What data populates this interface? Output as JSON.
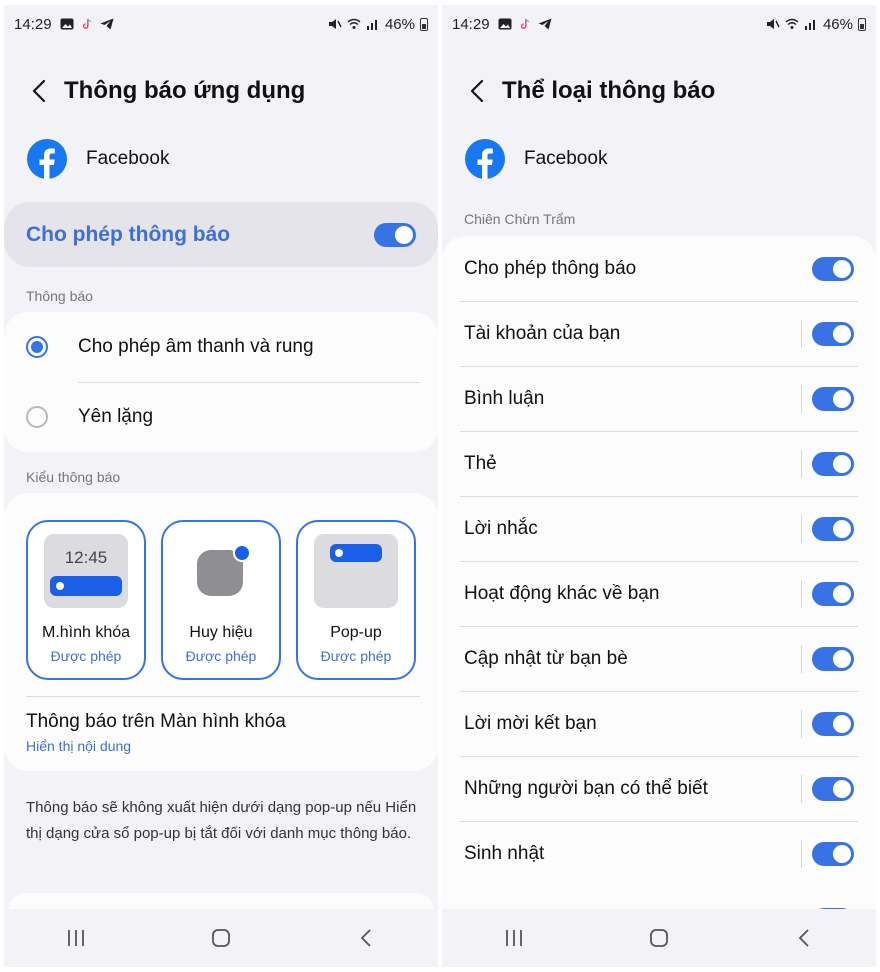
{
  "status_bar": {
    "time": "14:29",
    "battery": "46%"
  },
  "left": {
    "title": "Thông báo ứng dụng",
    "app_name": "Facebook",
    "allow_label": "Cho phép thông báo",
    "section_notifications": "Thông báo",
    "options": [
      {
        "label": "Cho phép âm thanh và rung",
        "selected": true
      },
      {
        "label": "Yên lặng",
        "selected": false
      }
    ],
    "section_style": "Kiểu thông báo",
    "styles": [
      {
        "label": "M.hình khóa",
        "status": "Được phép",
        "preview_time": "12:45"
      },
      {
        "label": "Huy hiệu",
        "status": "Được phép"
      },
      {
        "label": "Pop-up",
        "status": "Được phép"
      }
    ],
    "lockscreen": {
      "title": "Thông báo trên Màn hình khóa",
      "value": "Hiển thị nội dung"
    },
    "note": "Thông báo sẽ không xuất hiện dưới dạng pop-up nếu Hiển thị dạng cửa sổ pop-up bị tắt đối với danh mục thông báo."
  },
  "right": {
    "title": "Thể loại thông báo",
    "app_name": "Facebook",
    "section": "Chiên Chừn Trẩm",
    "categories": [
      {
        "label": "Cho phép thông báo",
        "on": true
      },
      {
        "label": "Tài khoản của bạn",
        "on": true
      },
      {
        "label": "Bình luận",
        "on": true
      },
      {
        "label": "Thẻ",
        "on": true
      },
      {
        "label": "Lời nhắc",
        "on": true
      },
      {
        "label": "Hoạt động khác về bạn",
        "on": true
      },
      {
        "label": "Cập nhật từ bạn bè",
        "on": true
      },
      {
        "label": "Lời mời kết bạn",
        "on": true
      },
      {
        "label": "Những người bạn có thể biết",
        "on": true
      },
      {
        "label": "Sinh nhật",
        "on": true
      }
    ]
  },
  "colors": {
    "accent": "#3873e6",
    "accent_text": "#3e6fd6",
    "facebook_blue": "#1877f2",
    "background": "#f3f3f7"
  },
  "icons": [
    "back-arrow",
    "facebook-logo",
    "recents",
    "home",
    "back",
    "gallery",
    "tiktok",
    "telegram",
    "mute",
    "wifi",
    "signal",
    "battery"
  ]
}
